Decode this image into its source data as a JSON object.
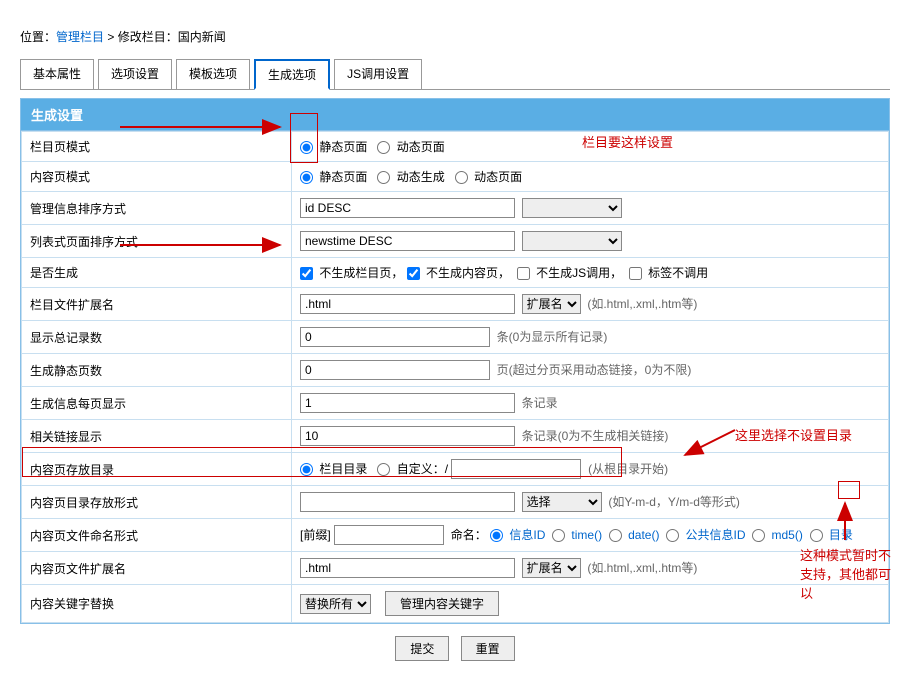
{
  "breadcrumb": {
    "prefix": "位置：",
    "link1": "管理栏目",
    "sep": " > ",
    "text2": "修改栏目：国内新闻"
  },
  "tabs": [
    "基本属性",
    "选项设置",
    "模板选项",
    "生成选项",
    "JS调用设置"
  ],
  "section_title": "生成设置",
  "rows": {
    "r1": {
      "label": "栏目页模式",
      "opt1": "静态页面",
      "opt2": "动态页面"
    },
    "r2": {
      "label": "内容页模式",
      "opt1": "静态页面",
      "opt2": "动态生成",
      "opt3": "动态页面"
    },
    "r3": {
      "label": "管理信息排序方式",
      "val": "id DESC"
    },
    "r4": {
      "label": "列表式页面排序方式",
      "val": "newstime DESC"
    },
    "r5": {
      "label": "是否生成",
      "c1": "不生成栏目页，",
      "c2": "不生成内容页，",
      "c3": "不生成JS调用，",
      "c4": "标签不调用"
    },
    "r6": {
      "label": "栏目文件扩展名",
      "val": ".html",
      "sel": "扩展名",
      "hint": "(如.html,.xml,.htm等)"
    },
    "r7": {
      "label": "显示总记录数",
      "val": "0",
      "hint": "条(0为显示所有记录)"
    },
    "r8": {
      "label": "生成静态页数",
      "val": "0",
      "hint": "页(超过分页采用动态链接，0为不限)"
    },
    "r9": {
      "label": "生成信息每页显示",
      "val": "1",
      "hint": "条记录"
    },
    "r10": {
      "label": "相关链接显示",
      "val": "10",
      "hint": "条记录(0为不生成相关链接)"
    },
    "r11": {
      "label": "内容页存放目录",
      "opt1": "栏目目录",
      "opt2": "自定义：/",
      "hint": "(从根目录开始)"
    },
    "r12": {
      "label": "内容页目录存放形式",
      "val": "",
      "sel": "选择",
      "hint": "(如Y-m-d，Y/m-d等形式)"
    },
    "r13": {
      "label": "内容页文件命名形式",
      "prefix": "[前缀]",
      "mid": "命名：",
      "o1": "信息ID",
      "o2": "time()",
      "o3": "date()",
      "o4": "公共信息ID",
      "o5": "md5()",
      "o6": "目录"
    },
    "r14": {
      "label": "内容页文件扩展名",
      "val": ".html",
      "sel": "扩展名",
      "hint": "(如.html,.xml,.htm等)"
    },
    "r15": {
      "label": "内容关键字替换",
      "sel": "替换所有",
      "btn": "管理内容关键字"
    }
  },
  "buttons": {
    "submit": "提交",
    "reset": "重置"
  },
  "annotations": {
    "a1": "栏目要这样设置",
    "a2": "这里选择不设置目录",
    "a3": "这种模式暂时不支持，其他都可以"
  }
}
